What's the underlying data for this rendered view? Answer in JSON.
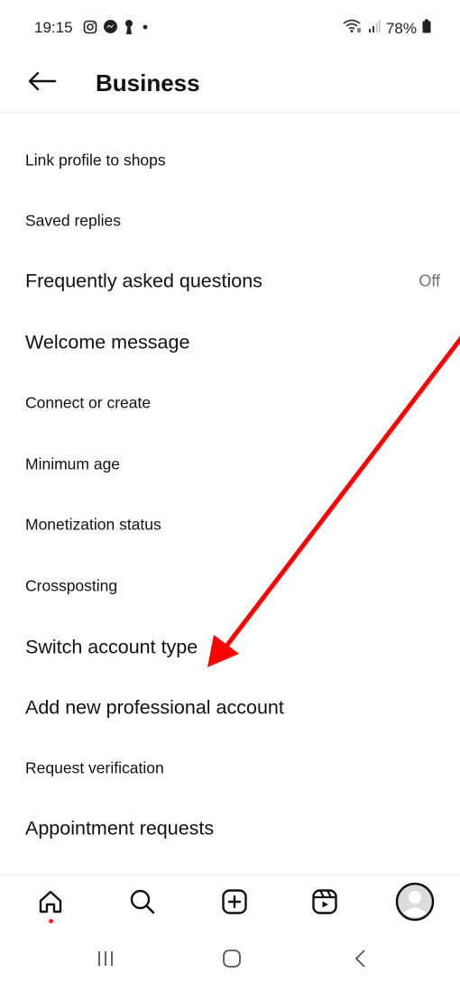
{
  "status_bar": {
    "time": "19:15",
    "left_icons": [
      "instagram-icon",
      "messenger-icon",
      "keyhole-icon",
      "dot-icon"
    ],
    "right_icons": [
      "wifi-icon",
      "signal-icon",
      "battery-icon"
    ],
    "battery": "78%"
  },
  "header": {
    "back_icon": "arrow-left-icon",
    "title": "Business"
  },
  "menu": [
    {
      "label": "Link profile to shops",
      "value": ""
    },
    {
      "label": "Saved replies",
      "value": ""
    },
    {
      "label": "Frequently asked questions",
      "value": "Off"
    },
    {
      "label": "Welcome message",
      "value": ""
    },
    {
      "label": "Connect or create",
      "value": ""
    },
    {
      "label": "Minimum age",
      "value": ""
    },
    {
      "label": "Monetization status",
      "value": ""
    },
    {
      "label": "Crossposting",
      "value": ""
    },
    {
      "label": "Switch account type",
      "value": ""
    },
    {
      "label": "Add new professional account",
      "value": ""
    },
    {
      "label": "Request verification",
      "value": ""
    },
    {
      "label": "Appointment requests",
      "value": ""
    }
  ],
  "annotation": {
    "color": "#ff0000"
  },
  "bottom_nav": [
    "home-icon",
    "search-icon",
    "create-post-icon",
    "reels-icon",
    "profile-avatar-icon"
  ],
  "system_nav": [
    "recents-icon",
    "home-circle-icon",
    "back-chevron-icon"
  ],
  "colors": {
    "text": "#111111",
    "secondary": "#737373",
    "notification": "#ff2a2a"
  }
}
